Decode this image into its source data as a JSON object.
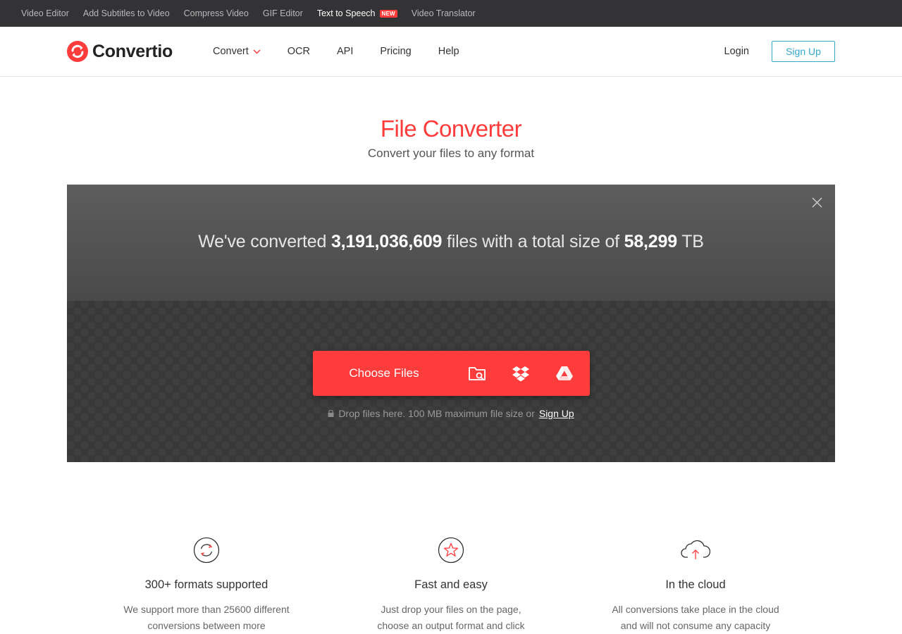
{
  "topbar": {
    "links": [
      "Video Editor",
      "Add Subtitles to Video",
      "Compress Video",
      "GIF Editor",
      "Text to Speech",
      "Video Translator"
    ],
    "new_badge": "NEW"
  },
  "header": {
    "brand": "Convertio",
    "nav": [
      "Convert",
      "OCR",
      "API",
      "Pricing",
      "Help"
    ],
    "login": "Login",
    "signup": "Sign Up"
  },
  "hero": {
    "title": "File Converter",
    "subtitle": "Convert your files to any format"
  },
  "stats": {
    "prefix": "We've converted ",
    "files_count": "3,191,036,609",
    "middle": " files with a total size of ",
    "size": "58,299",
    "unit": " TB"
  },
  "upload": {
    "choose_label": "Choose Files",
    "hint": "Drop files here. 100 MB maximum file size or",
    "hint_link": "Sign Up"
  },
  "features": [
    {
      "title": "300+ formats supported",
      "text": "We support more than 25600 different conversions between more"
    },
    {
      "title": "Fast and easy",
      "text": "Just drop your files on the page, choose an output format and click"
    },
    {
      "title": "In the cloud",
      "text": "All conversions take place in the cloud and will not consume any capacity"
    }
  ],
  "colors": {
    "accent": "#ff3c3c",
    "signup": "#33a7c9",
    "topbar": "#333335"
  }
}
